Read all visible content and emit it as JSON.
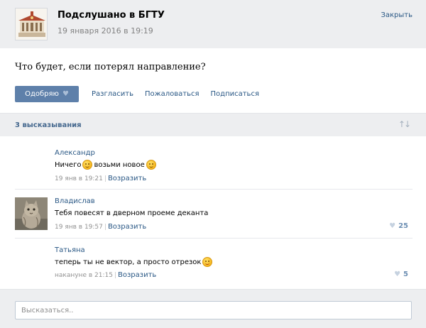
{
  "header": {
    "group_name": "Подслушано в БГТУ",
    "date": "19 января 2016 в 19:19",
    "close_label": "Закрыть"
  },
  "post": {
    "text": "Что будет, если потерял направление?",
    "approve_label": "Одобряю",
    "actions": [
      "Разгласить",
      "Пожаловаться",
      "Подписаться"
    ]
  },
  "comments_bar": {
    "count_label": "3 высказывания",
    "sort_icon": "sort-arrows-icon"
  },
  "comments": [
    {
      "author": "Александр",
      "text_parts": [
        "Ничего",
        "возьми новое"
      ],
      "time": "19 янв в 19:21",
      "reply_label": "Возразить",
      "likes": "",
      "has_avatar": false
    },
    {
      "author": "Владислав",
      "text": "Тебя повесят в дверном проеме деканта",
      "time": "19 янв в 19:57",
      "reply_label": "Возразить",
      "likes": "25",
      "has_avatar": true
    },
    {
      "author": "Татьяна",
      "text": "теперь ты не вектор, а просто отрезок",
      "time": "накануне в 21:15",
      "reply_label": "Возразить",
      "likes": "5",
      "has_avatar": false
    }
  ],
  "input": {
    "placeholder": "Высказаться..",
    "value": ""
  },
  "colors": {
    "accent": "#5e80aa",
    "link": "#2a5885",
    "panel_bg": "#edeef0"
  }
}
